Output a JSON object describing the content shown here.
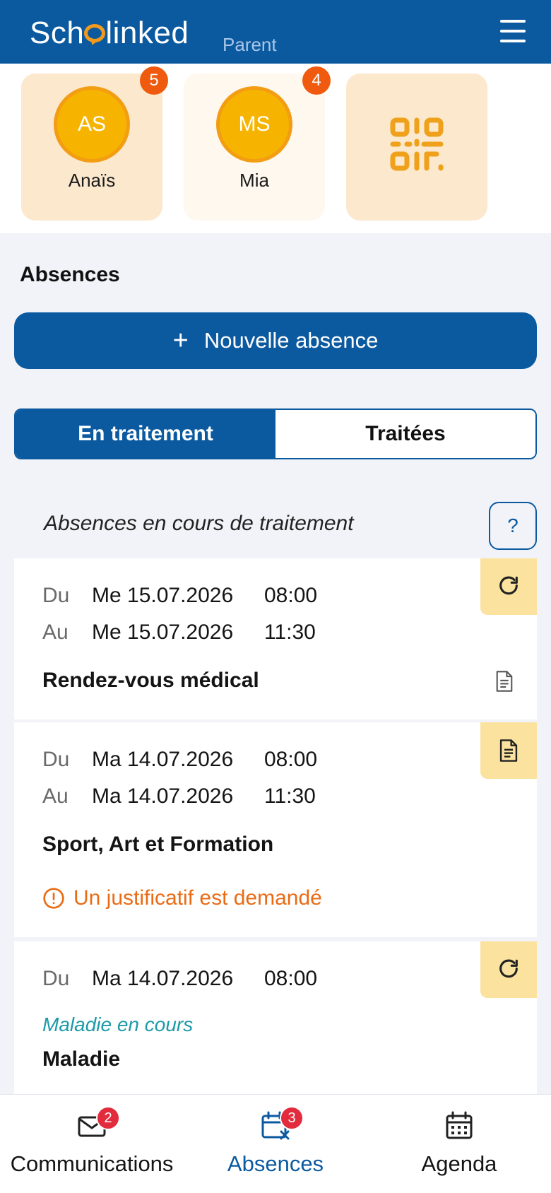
{
  "header": {
    "logo_text_before": "Sch",
    "logo_text_after": "linked",
    "role_label": "Parent",
    "menu_icon": "hamburger-menu-icon"
  },
  "students": [
    {
      "initials": "AS",
      "name": "Anaïs",
      "badge": "5",
      "selected": true
    },
    {
      "initials": "MS",
      "name": "Mia",
      "badge": "4",
      "selected": false
    }
  ],
  "qr_card": {
    "icon": "qr-code-icon"
  },
  "absences": {
    "title": "Absences",
    "new_button_icon": "+",
    "new_button_label": "Nouvelle absence",
    "tabs": [
      {
        "label": "En traitement",
        "active": true
      },
      {
        "label": "Traitées",
        "active": false
      }
    ],
    "list_caption": "Absences en cours de traitement",
    "help_label": "?",
    "items": [
      {
        "from_label": "Du",
        "from_date": "Me 15.07.2026",
        "from_time": "08:00",
        "to_label": "Au",
        "to_date": "Me 15.07.2026",
        "to_time": "11:30",
        "reason": "Rendez-vous médical",
        "status_icon": "refresh-icon",
        "attachment_icon": "document-icon"
      },
      {
        "from_label": "Du",
        "from_date": "Ma 14.07.2026",
        "from_time": "08:00",
        "to_label": "Au",
        "to_date": "Ma 14.07.2026",
        "to_time": "11:30",
        "reason": "Sport, Art et Formation",
        "status_icon": "document-icon",
        "warning": "Un justificatif est demandé"
      },
      {
        "from_label": "Du",
        "from_date": "Ma 14.07.2026",
        "from_time": "08:00",
        "status_text": "Maladie en cours",
        "reason": "Maladie",
        "status_icon": "refresh-icon"
      }
    ]
  },
  "bottom_nav": [
    {
      "label": "Communications",
      "icon": "envelope-icon",
      "badge": "2",
      "current": false
    },
    {
      "label": "Absences",
      "icon": "calendar-x-icon",
      "badge": "3",
      "current": true
    },
    {
      "label": "Agenda",
      "icon": "calendar-icon",
      "current": false
    }
  ],
  "colors": {
    "primary": "#0b5aa0",
    "accent_orange": "#f39a1d",
    "badge_orange": "#ef5a0f",
    "warning": "#e96b15",
    "status_teal": "#1c9aa8",
    "nav_badge_red": "#e22b3c"
  }
}
